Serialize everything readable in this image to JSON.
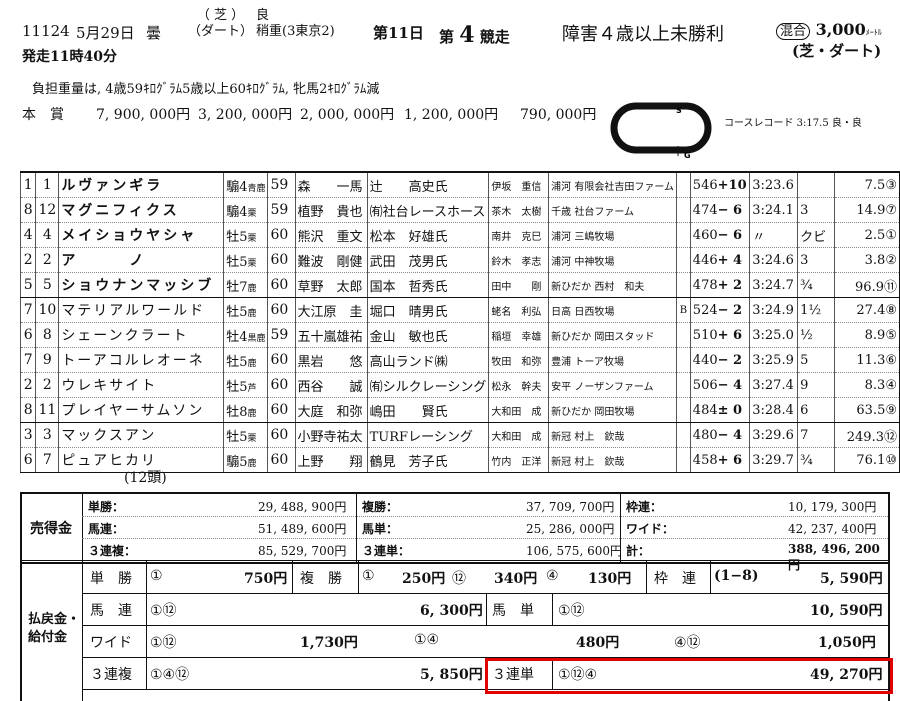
{
  "header": {
    "race_code": "11124",
    "date": "5月29日",
    "weather": "曇",
    "surface_top": "（ 芝 ）",
    "surface_bottom": "（ダート）",
    "cond_top": "良",
    "cond_bottom": "稍重(3東京2)",
    "day": "第11日",
    "race_prefix": "第",
    "race_num": "4",
    "race_suffix": "競走",
    "race_name": "障害４歳以上未勝利",
    "mixed_badge": "混合",
    "distance": "3,000",
    "distance_unit": "ﾒｰﾄﾙ",
    "surface_combo": "(芝・ダート)",
    "post_time": "発走11時40分",
    "weight_note": "負担重量は, 4歳59ｷﾛｸﾞﾗﾑ5歳以上60ｷﾛｸﾞﾗﾑ, 牝馬2ｷﾛｸﾞﾗﾑ減",
    "prize_label": "本賞",
    "prizes": [
      "7, 900, 000円",
      "3, 200, 000円",
      "2, 000, 000円",
      "1, 200, 000円",
      "790, 000円"
    ],
    "course_record": "コースレコード 3:17.5 良・良",
    "track_start": "S",
    "track_goal": "G"
  },
  "results": [
    {
      "fin": "1",
      "num": "1",
      "name": "ルヴァンギラ",
      "sex": "騸4",
      "coat": "青鹿",
      "wt": "59",
      "jockey": "森　　一馬",
      "trainer": "辻　　高史氏",
      "owner": "伊坂　重信",
      "region": "浦河",
      "breeder": "有限会社吉田ファーム",
      "blinker": "",
      "bw": "546",
      "chg": "+10",
      "time": "3:23.6",
      "margin": "",
      "odds": "7.5",
      "pop": "③",
      "bold": true
    },
    {
      "fin": "8",
      "num": "12",
      "name": "マグニフィクス",
      "sex": "騸4",
      "coat": "栗",
      "wt": "59",
      "jockey": "植野　貴也",
      "trainer": "㈲社台レースホース",
      "owner": "茶木　太樹",
      "region": "千歳",
      "breeder": "社台ファーム",
      "blinker": "",
      "bw": "474",
      "chg": "− 6",
      "time": "3:24.1",
      "margin": "3",
      "odds": "14.9",
      "pop": "⑦",
      "bold": true
    },
    {
      "fin": "4",
      "num": "4",
      "name": "メイショウヤシャ",
      "sex": "牡5",
      "coat": "栗",
      "wt": "60",
      "jockey": "熊沢　重文",
      "trainer": "松本　好雄氏",
      "owner": "南井　克巳",
      "region": "浦河",
      "breeder": "三嶋牧場",
      "blinker": "",
      "bw": "460",
      "chg": "− 6",
      "time": "〃",
      "margin": "クビ",
      "odds": "2.5",
      "pop": "①",
      "bold": true
    },
    {
      "fin": "2",
      "num": "2",
      "name": "ア　　　ノ",
      "sex": "牡5",
      "coat": "栗",
      "wt": "60",
      "jockey": "難波　剛健",
      "trainer": "武田　茂男氏",
      "owner": "鈴木　孝志",
      "region": "浦河",
      "breeder": "中神牧場",
      "blinker": "",
      "bw": "446",
      "chg": "+ 4",
      "time": "3:24.6",
      "margin": "3",
      "odds": "3.8",
      "pop": "②",
      "bold": true
    },
    {
      "fin": "5",
      "num": "5",
      "name": "ショウナンマッシブ",
      "sex": "牡7",
      "coat": "鹿",
      "wt": "60",
      "jockey": "草野　太郎",
      "trainer": "国本　哲秀氏",
      "owner": "田中　　剛",
      "region": "新ひだか",
      "breeder": "西村　和夫",
      "blinker": "",
      "bw": "478",
      "chg": "+ 2",
      "time": "3:24.7",
      "margin": "¾",
      "odds": "96.9",
      "pop": "⑪",
      "bold": true
    },
    {
      "fin": "7",
      "num": "10",
      "name": "マテリアルワールド",
      "sex": "牡5",
      "coat": "鹿",
      "wt": "60",
      "jockey": "大江原　圭",
      "trainer": "堀口　晴男氏",
      "owner": "蛯名　利弘",
      "region": "日高",
      "breeder": "日西牧場",
      "blinker": "B",
      "bw": "524",
      "chg": "− 2",
      "time": "3:24.9",
      "margin": "1½",
      "odds": "27.4",
      "pop": "⑧",
      "bold": false
    },
    {
      "fin": "6",
      "num": "8",
      "name": "シェーンクラート",
      "sex": "牡4",
      "coat": "黒鹿",
      "wt": "59",
      "jockey": "五十嵐雄祐",
      "trainer": "金山　敏也氏",
      "owner": "稲垣　幸雄",
      "region": "新ひだか",
      "breeder": "岡田スタッド",
      "blinker": "",
      "bw": "510",
      "chg": "+ 6",
      "time": "3:25.0",
      "margin": "½",
      "odds": "8.9",
      "pop": "⑤",
      "bold": false
    },
    {
      "fin": "7",
      "num": "9",
      "name": "トーアコルレオーネ",
      "sex": "牡5",
      "coat": "鹿",
      "wt": "60",
      "jockey": "黒岩　　悠",
      "trainer": "高山ランド㈱",
      "owner": "牧田　和弥",
      "region": "豊浦",
      "breeder": "トーア牧場",
      "blinker": "",
      "bw": "440",
      "chg": "− 2",
      "time": "3:25.9",
      "margin": "5",
      "odds": "11.3",
      "pop": "⑥",
      "bold": false
    },
    {
      "fin": "2",
      "num": "2",
      "name": "ウレキサイト",
      "sex": "牡5",
      "coat": "芦",
      "wt": "60",
      "jockey": "西谷　　誠",
      "trainer": "㈲シルクレーシング",
      "owner": "松永　幹夫",
      "region": "安平",
      "breeder": "ノーザンファーム",
      "blinker": "",
      "bw": "506",
      "chg": "− 4",
      "time": "3:27.4",
      "margin": "9",
      "odds": "8.3",
      "pop": "④",
      "bold": false
    },
    {
      "fin": "8",
      "num": "11",
      "name": "プレイヤーサムソン",
      "sex": "牡8",
      "coat": "鹿",
      "wt": "60",
      "jockey": "大庭　和弥",
      "trainer": "嶋田　　賢氏",
      "owner": "大和田　成",
      "region": "新ひだか",
      "breeder": "岡田牧場",
      "blinker": "",
      "bw": "484",
      "chg": "± 0",
      "time": "3:28.4",
      "margin": "6",
      "odds": "63.5",
      "pop": "⑨",
      "bold": false
    },
    {
      "fin": "3",
      "num": "3",
      "name": "マックスアン",
      "sex": "牡5",
      "coat": "栗",
      "wt": "60",
      "jockey": "小野寺祐太",
      "trainer": "TURFレーシング",
      "owner": "大和田　成",
      "region": "新冠",
      "breeder": "村上　欽哉",
      "blinker": "",
      "bw": "480",
      "chg": "− 4",
      "time": "3:29.6",
      "margin": "7",
      "odds": "249.3",
      "pop": "⑫",
      "bold": false
    },
    {
      "fin": "6",
      "num": "7",
      "name": "ピュアヒカリ",
      "sex": "騸5",
      "coat": "鹿",
      "wt": "60",
      "jockey": "上野　　翔",
      "trainer": "鶴見　芳子氏",
      "owner": "竹内　正洋",
      "region": "新冠",
      "breeder": "村上　欽哉",
      "blinker": "",
      "bw": "458",
      "chg": "+ 6",
      "time": "3:29.7",
      "margin": "¾",
      "odds": "76.1",
      "pop": "⑩",
      "bold": false
    }
  ],
  "horse_count": "(12頭)",
  "sales": {
    "label": "売得金",
    "tansho_label": "単勝：",
    "tansho": "29, 488, 900円",
    "fukusho_label": "複勝：",
    "fukusho": "37, 709, 700円",
    "wakuren_label": "枠連：",
    "wakuren": "10, 179, 300円",
    "umaren_label": "馬連：",
    "umaren": "51, 489, 600円",
    "umatan_label": "馬単：",
    "umatan": "25, 286, 000円",
    "wide_label": "ワイド：",
    "wide": "42, 237, 400円",
    "sanrenpuku_label": "３連複：",
    "sanrenpuku": "85, 529, 700円",
    "sanrentan_label": "３連単：",
    "sanrentan": "106, 575, 600円",
    "total_label": "計：",
    "total": "388, 496, 200円"
  },
  "payout": {
    "label1": "払戻金・",
    "label2": "給付金",
    "tansho_label": "単　勝",
    "tansho_combo": "①",
    "tansho_amt": "750円",
    "fukusho_label": "複　勝",
    "fukusho": [
      {
        "combo": "①",
        "amt": "250円"
      },
      {
        "combo": "⑫",
        "amt": "340円"
      },
      {
        "combo": "④",
        "amt": "130円"
      }
    ],
    "wakuren_label": "枠　連",
    "wakuren_combo": "(1−8)",
    "wakuren_amt": "5, 590円",
    "umaren_label": "馬　連",
    "umaren_combo": "①⑫",
    "umaren_amt": "6, 300円",
    "umatan_label": "馬　単",
    "umatan_combo": "①⑫",
    "umatan_amt": "10, 590円",
    "wide_label": "ワイド",
    "wide": [
      {
        "combo": "①⑫",
        "amt": "1,730円"
      },
      {
        "combo": "①④",
        "amt": "480円"
      },
      {
        "combo": "④⑫",
        "amt": "1,050円"
      }
    ],
    "sanrenpuku_label": "３連複",
    "sanrenpuku_combo": "①④⑫",
    "sanrenpuku_amt": "5, 850円",
    "sanrentan_label": "３連単",
    "sanrentan_combo": "①⑫④",
    "sanrentan_amt": "49, 270円"
  },
  "colors": {
    "highlight": "#e00000"
  }
}
